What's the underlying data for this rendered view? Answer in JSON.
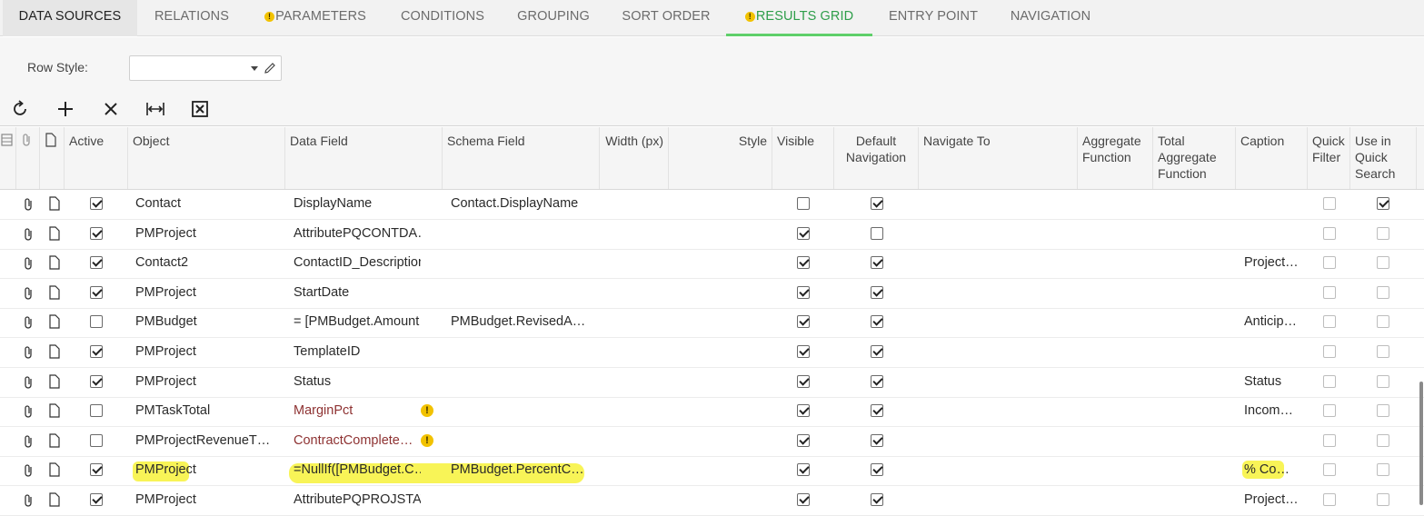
{
  "tabs": [
    {
      "label": "DATA SOURCES",
      "warning": false
    },
    {
      "label": "RELATIONS",
      "warning": false
    },
    {
      "label": "PARAMETERS",
      "warning": true
    },
    {
      "label": "CONDITIONS",
      "warning": false
    },
    {
      "label": "GROUPING",
      "warning": false
    },
    {
      "label": "SORT ORDER",
      "warning": false
    },
    {
      "label": "RESULTS GRID",
      "warning": true
    },
    {
      "label": "ENTRY POINT",
      "warning": false
    },
    {
      "label": "NAVIGATION",
      "warning": false
    }
  ],
  "form": {
    "row_style_label": "Row Style:",
    "row_style_value": ""
  },
  "toolbar": {
    "refresh": "refresh-icon",
    "add": "plus-icon",
    "delete": "close-icon",
    "fit": "fit-columns-icon",
    "export": "excel-export-icon"
  },
  "grid": {
    "headers": {
      "active": "Active",
      "object": "Object",
      "data_field": "Data Field",
      "schema_field": "Schema Field",
      "width": "Width (px)",
      "style": "Style",
      "visible": "Visible",
      "default_nav": "Default Navigation",
      "navigate_to": "Navigate To",
      "aggregate": "Aggregate Function",
      "total_aggregate": "Total Aggregate Function",
      "caption": "Caption",
      "quick_filter": "Quick Filter",
      "quick_search": "Use in Quick Search"
    },
    "rows": [
      {
        "active": true,
        "object": "Contact",
        "data_field": "DisplayName",
        "data_field_warning": false,
        "schema_field": "Contact.DisplayName",
        "visible": false,
        "default_nav": true,
        "caption": "",
        "quick_filter": false,
        "quick_search": true
      },
      {
        "active": true,
        "object": "PMProject",
        "data_field": "AttributePQCONTDA…",
        "data_field_warning": false,
        "schema_field": "",
        "visible": true,
        "default_nav": false,
        "caption": "",
        "quick_filter": false,
        "quick_search": false
      },
      {
        "active": true,
        "object": "Contact2",
        "data_field": "ContactID_Description",
        "data_field_warning": false,
        "schema_field": "",
        "visible": true,
        "default_nav": true,
        "caption": "Project…",
        "quick_filter": false,
        "quick_search": false
      },
      {
        "active": true,
        "object": "PMProject",
        "data_field": "StartDate",
        "data_field_warning": false,
        "schema_field": "",
        "visible": true,
        "default_nav": true,
        "caption": "",
        "quick_filter": false,
        "quick_search": false
      },
      {
        "active": false,
        "object": "PMBudget",
        "data_field": "= [PMBudget.Amount…",
        "data_field_warning": false,
        "schema_field": "PMBudget.RevisedA…",
        "visible": true,
        "default_nav": true,
        "caption": "Anticip…",
        "quick_filter": false,
        "quick_search": false
      },
      {
        "active": true,
        "object": "PMProject",
        "data_field": "TemplateID",
        "data_field_warning": false,
        "schema_field": "",
        "visible": true,
        "default_nav": true,
        "caption": "",
        "quick_filter": false,
        "quick_search": false
      },
      {
        "active": true,
        "object": "PMProject",
        "data_field": "Status",
        "data_field_warning": false,
        "schema_field": "",
        "visible": true,
        "default_nav": true,
        "caption": "Status",
        "quick_filter": false,
        "quick_search": false
      },
      {
        "active": false,
        "object": "PMTaskTotal",
        "data_field": "MarginPct",
        "data_field_warning": true,
        "schema_field": "",
        "visible": true,
        "default_nav": true,
        "caption": "Incom…",
        "quick_filter": false,
        "quick_search": false
      },
      {
        "active": false,
        "object": "PMProjectRevenueT…",
        "data_field": "ContractComplete…",
        "data_field_warning": true,
        "schema_field": "",
        "visible": true,
        "default_nav": true,
        "caption": "",
        "quick_filter": false,
        "quick_search": false
      },
      {
        "active": true,
        "object": "PMProject",
        "data_field": "=NullIf([PMBudget.C…",
        "data_field_warning": false,
        "schema_field": "PMBudget.PercentC…",
        "visible": true,
        "default_nav": true,
        "caption": "% Co…",
        "quick_filter": false,
        "quick_search": false,
        "highlighted": true
      },
      {
        "active": true,
        "object": "PMProject",
        "data_field": "AttributePQPROJSTAT",
        "data_field_warning": false,
        "schema_field": "",
        "visible": true,
        "default_nav": true,
        "caption": "Project…",
        "quick_filter": false,
        "quick_search": false
      }
    ]
  },
  "colors": {
    "accent_green": "#5fcf6a",
    "warning_yellow": "#f2c200",
    "highlighter": "#f7f23a",
    "formula_red": "#8e3232"
  }
}
